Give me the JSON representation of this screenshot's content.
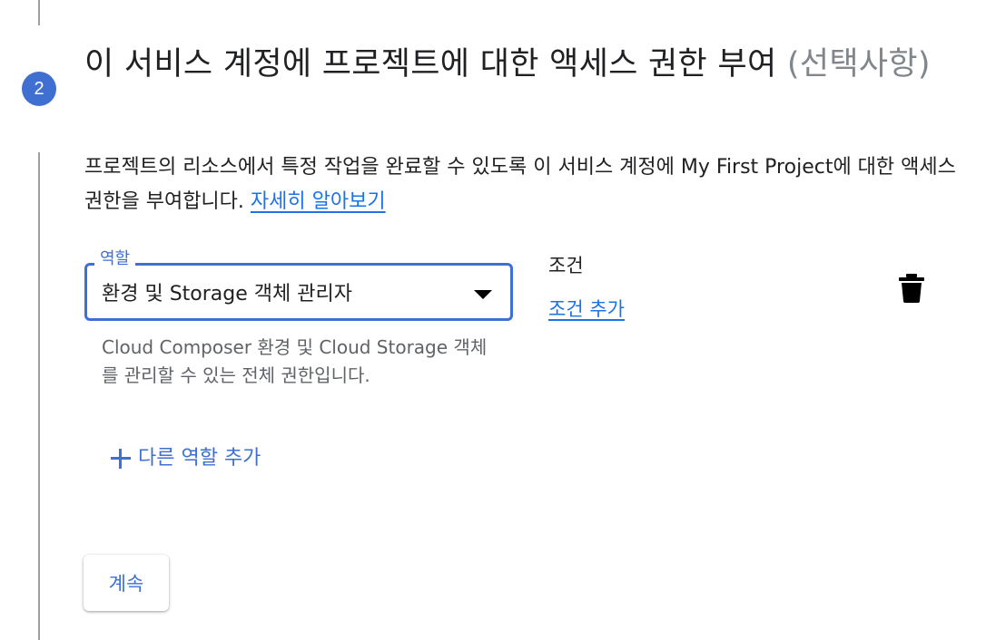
{
  "step": {
    "number": "2",
    "title_main": "이 서비스 계정에 프로젝트에 대한 액세스 권한 부여",
    "title_optional": "(선택사항)"
  },
  "description": {
    "text": "프로젝트의 리소스에서 특정 작업을 완료할 수 있도록 이 서비스 계정에 My First Project에 대한 액세스 권한을 부여합니다.",
    "learn_more": "자세히 알아보기"
  },
  "role_field": {
    "label": "역할",
    "value": "환경 및 Storage 객체 관리자",
    "help": "Cloud Composer 환경 및 Cloud Storage 객체를 관리할 수 있는 전체 권한입니다."
  },
  "condition": {
    "label": "조건",
    "add_label": "조건 추가"
  },
  "add_role": {
    "label": "다른 역할 추가"
  },
  "continue_button": {
    "label": "계속"
  },
  "icons": {
    "delete": "trash-icon",
    "add": "plus-icon",
    "dropdown": "dropdown-arrow-icon"
  },
  "colors": {
    "accent": "#3f6fd1",
    "link": "#1a73e8",
    "muted": "#5f6368"
  }
}
